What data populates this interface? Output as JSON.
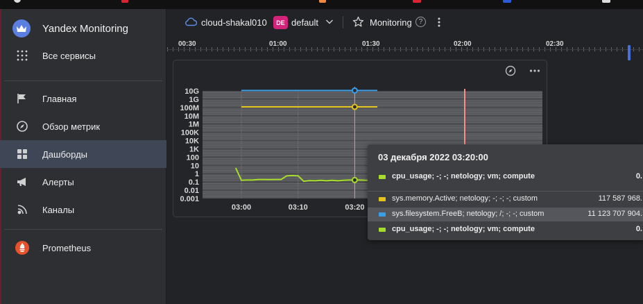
{
  "sidebar": {
    "app_title": "Yandex Monitoring",
    "all_services": "Все сервисы",
    "items": [
      {
        "label": "Главная",
        "icon": "flag-icon"
      },
      {
        "label": "Обзор метрик",
        "icon": "compass-icon"
      },
      {
        "label": "Дашборды",
        "icon": "dashboard-grid-icon"
      },
      {
        "label": "Алерты",
        "icon": "megaphone-icon"
      },
      {
        "label": "Каналы",
        "icon": "broadcast-icon"
      }
    ],
    "active_item": "Дашборды",
    "extra": {
      "label": "Prometheus",
      "icon": "prometheus-icon"
    }
  },
  "breadcrumbs": {
    "cloud": "cloud-shakal010",
    "folder_badge": "DE",
    "folder": "default",
    "service": "Monitoring",
    "help": "?"
  },
  "timeline": {
    "labels": [
      "00:30",
      "01:00",
      "01:30",
      "02:00",
      "02:30"
    ]
  },
  "chart_data": {
    "type": "line",
    "y_scale": "log",
    "y_tick_labels": [
      "10G",
      "1G",
      "100M",
      "10M",
      "1M",
      "100K",
      "10K",
      "1K",
      "100",
      "10",
      "1",
      "0.1",
      "0.01",
      "0.001"
    ],
    "x_tick_labels": [
      "03:00",
      "03:10",
      "03:20"
    ],
    "series": [
      {
        "name": "sys.filesystem.FreeB; netology; /; -; -; custom",
        "color": "#3d9ee8",
        "x_minutes": [
          0,
          24
        ],
        "y": [
          11123707904,
          11123707904
        ]
      },
      {
        "name": "sys.memory.Active; netology; -; -; -; custom",
        "color": "#e7c21b",
        "x_minutes": [
          0,
          24
        ],
        "y": [
          117587968,
          117587968
        ]
      },
      {
        "name": "cpu_usage; -; -; netology; vm; compute",
        "color": "#a6dd2a",
        "x_minutes": [
          -1,
          0,
          1,
          2,
          3,
          4,
          5,
          6,
          7,
          8,
          9,
          10,
          11,
          12,
          13,
          14,
          15,
          16,
          17,
          18,
          19,
          20,
          21,
          22,
          23,
          24
        ],
        "y": [
          5,
          0.16,
          0.17,
          0.17,
          0.2,
          0.2,
          0.19,
          0.2,
          0.2,
          0.55,
          0.6,
          0.55,
          0.12,
          0.15,
          0.14,
          0.16,
          0.14,
          0.16,
          0.14,
          0.16,
          0.17,
          0.17,
          0.17,
          0.16,
          0.17,
          0.17
        ]
      }
    ],
    "cursor_time_minutes": 20
  },
  "tooltip": {
    "title": "03 декабря 2022 03:20:00",
    "rows": [
      {
        "name": "cpu_usage; -; -; netology; vm; compute",
        "value": "0.",
        "color": "#a6dd2a",
        "bold": true,
        "highlight": false
      },
      {
        "name": "sys.memory.Active; netology; -; -; -; custom",
        "value": "117 587 968.",
        "color": "#e7c21b",
        "bold": false,
        "highlight": false
      },
      {
        "name": "sys.filesystem.FreeB; netology; /; -; -; custom",
        "value": "11 123 707 904.",
        "color": "#3d9ee8",
        "bold": false,
        "highlight": true
      },
      {
        "name": "cpu_usage; -; -; netology; vm; compute",
        "value": "0.",
        "color": "#a6dd2a",
        "bold": true,
        "highlight": false
      }
    ]
  }
}
